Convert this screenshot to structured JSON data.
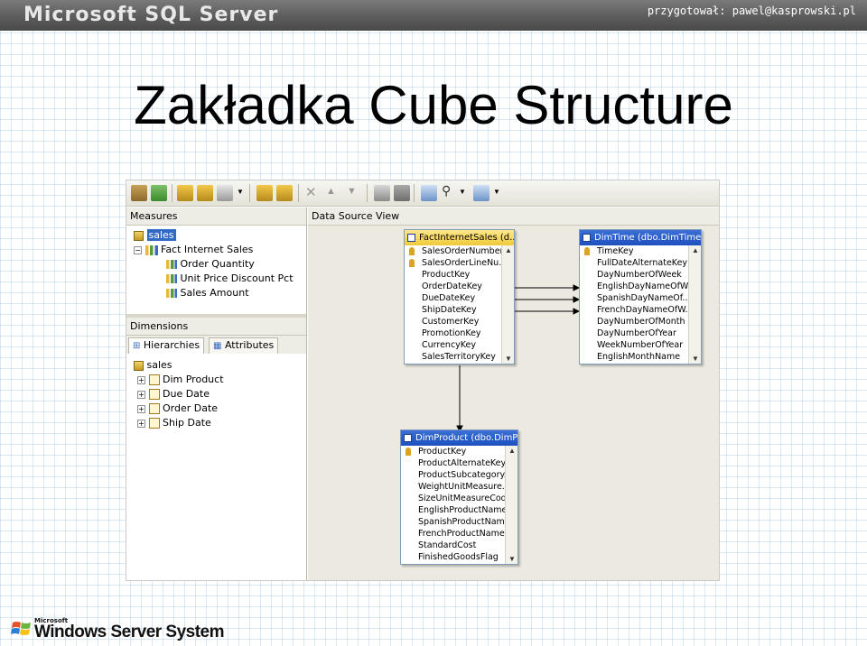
{
  "header": {
    "logo_text": "Microsoft SQL Server",
    "credit": "przygotował: pawel@kasprowski.pl"
  },
  "slide": {
    "title": "Zakładka Cube Structure"
  },
  "measures": {
    "heading": "Measures",
    "cube": "sales",
    "group": "Fact Internet Sales",
    "items": [
      "Order Quantity",
      "Unit Price Discount Pct",
      "Sales Amount"
    ]
  },
  "dimensions": {
    "heading": "Dimensions",
    "tabs": [
      "Hierarchies",
      "Attributes"
    ],
    "cube": "sales",
    "items": [
      "Dim Product",
      "Due Date",
      "Order Date",
      "Ship Date"
    ]
  },
  "dsv": {
    "heading": "Data Source View",
    "tables": [
      {
        "title": "FactInternetSales (d...",
        "columns": [
          "SalesOrderNumber",
          "SalesOrderLineNu...",
          "ProductKey",
          "OrderDateKey",
          "DueDateKey",
          "ShipDateKey",
          "CustomerKey",
          "PromotionKey",
          "CurrencyKey",
          "SalesTerritoryKey"
        ]
      },
      {
        "title": "DimTime (dbo.DimTime)",
        "columns": [
          "TimeKey",
          "FullDateAlternateKey",
          "DayNumberOfWeek",
          "EnglishDayNameOfW...",
          "SpanishDayNameOf...",
          "FrenchDayNameOfW...",
          "DayNumberOfMonth",
          "DayNumberOfYear",
          "WeekNumberOfYear",
          "EnglishMonthName"
        ]
      },
      {
        "title": "DimProduct (dbo.DimP...",
        "columns": [
          "ProductKey",
          "ProductAlternateKey",
          "ProductSubcategory...",
          "WeightUnitMeasure...",
          "SizeUnitMeasureCode",
          "EnglishProductName",
          "SpanishProductName",
          "FrenchProductName",
          "StandardCost",
          "FinishedGoodsFlag"
        ]
      }
    ]
  },
  "footer": {
    "brand_small": "Microsoft",
    "brand": "Windows Server System"
  },
  "colors": {
    "title_bar": "#2656c8",
    "selection": "#316ac5",
    "header_band": "#5c5c5c"
  }
}
